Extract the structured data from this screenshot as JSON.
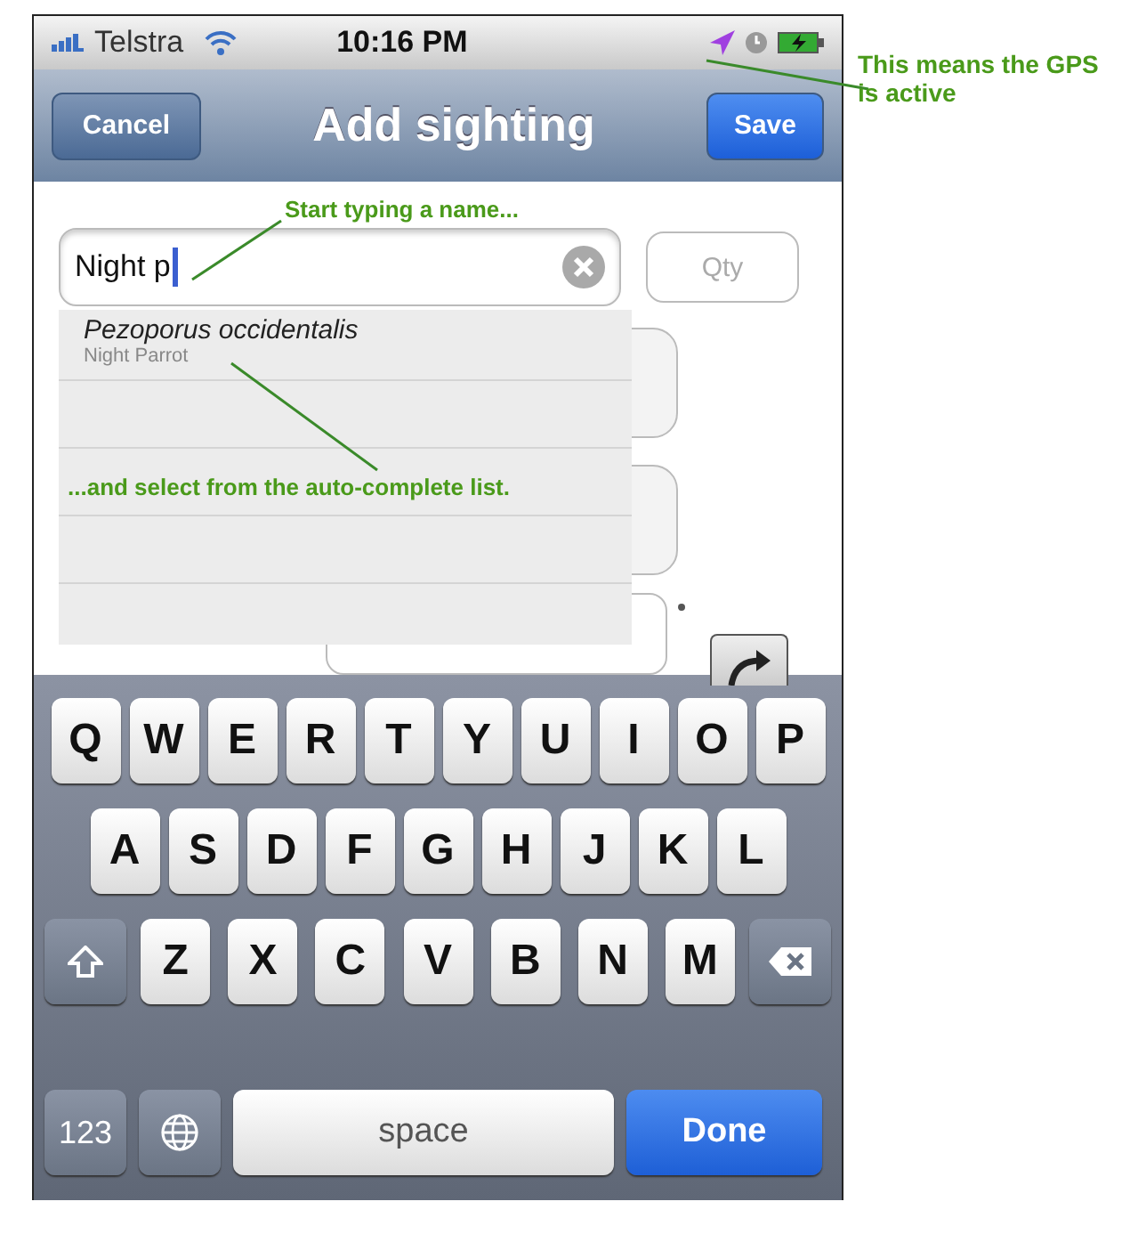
{
  "status_bar": {
    "carrier": "Telstra",
    "time": "10:16 PM",
    "gps_active": true
  },
  "nav_bar": {
    "left_button": "Cancel",
    "title": "Add sighting",
    "right_button": "Save"
  },
  "name_field": {
    "value": "Night p"
  },
  "qty_field": {
    "placeholder": "Qty"
  },
  "autocomplete": [
    {
      "scientific_name": "Pezoporus occidentalis",
      "common_name": "Night Parrot"
    }
  ],
  "keyboard": {
    "rows": [
      [
        "Q",
        "W",
        "E",
        "R",
        "T",
        "Y",
        "U",
        "I",
        "O",
        "P"
      ],
      [
        "A",
        "S",
        "D",
        "F",
        "G",
        "H",
        "J",
        "K",
        "L"
      ],
      [
        "Z",
        "X",
        "C",
        "V",
        "B",
        "N",
        "M"
      ]
    ],
    "number_key": "123",
    "space_key": "space",
    "return_key": "Done"
  },
  "annotations": [
    {
      "text": "This means the GPS is active"
    },
    {
      "text": "Start typing a name..."
    },
    {
      "text": "...and select from the auto-complete list."
    }
  ]
}
